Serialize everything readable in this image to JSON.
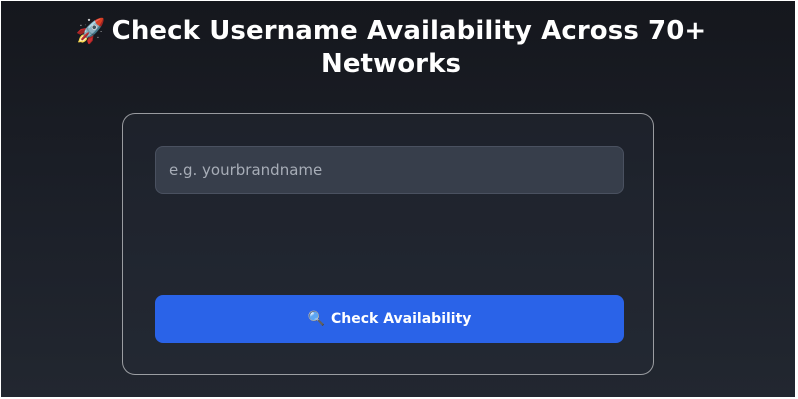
{
  "header": {
    "rocket_icon": "🚀",
    "title": "Check Username Availability Across 70+ Networks"
  },
  "form": {
    "username_placeholder": "e.g. yourbrandname",
    "username_value": "",
    "button_icon": "🔍",
    "button_label": "Check Availability"
  },
  "colors": {
    "accent": "#2a63e8",
    "background": "#1c2029",
    "input_background": "#373e4b"
  }
}
